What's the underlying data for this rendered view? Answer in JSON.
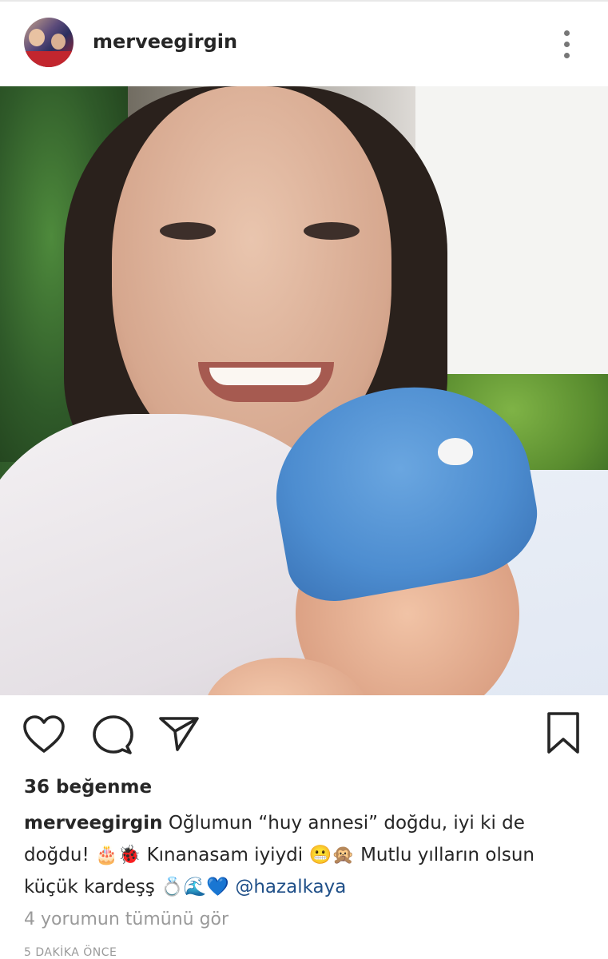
{
  "post": {
    "username": "merveegirgin",
    "likes_text": "36 beğenme",
    "caption_username": "merveegirgin",
    "caption_text_1": "Oğlumun “huy annesi” doğdu, iyi ki de doğdu! 🎂🐞 Kınanasam iyiydi 😬🙊 Mutlu yılların olsun küçük kardeşş 💍🌊💙 ",
    "caption_mention": "@hazalkaya",
    "view_comments": "4 yorumun tümünü gör",
    "timestamp": "5 DAKİKA ÖNCE"
  },
  "icons": {
    "more": "more-vertical-icon",
    "like": "heart-icon",
    "comment": "comment-icon",
    "share": "send-icon",
    "save": "bookmark-icon"
  },
  "colors": {
    "text": "#262626",
    "muted": "#9a9a9a",
    "mention": "#1f4f88"
  }
}
